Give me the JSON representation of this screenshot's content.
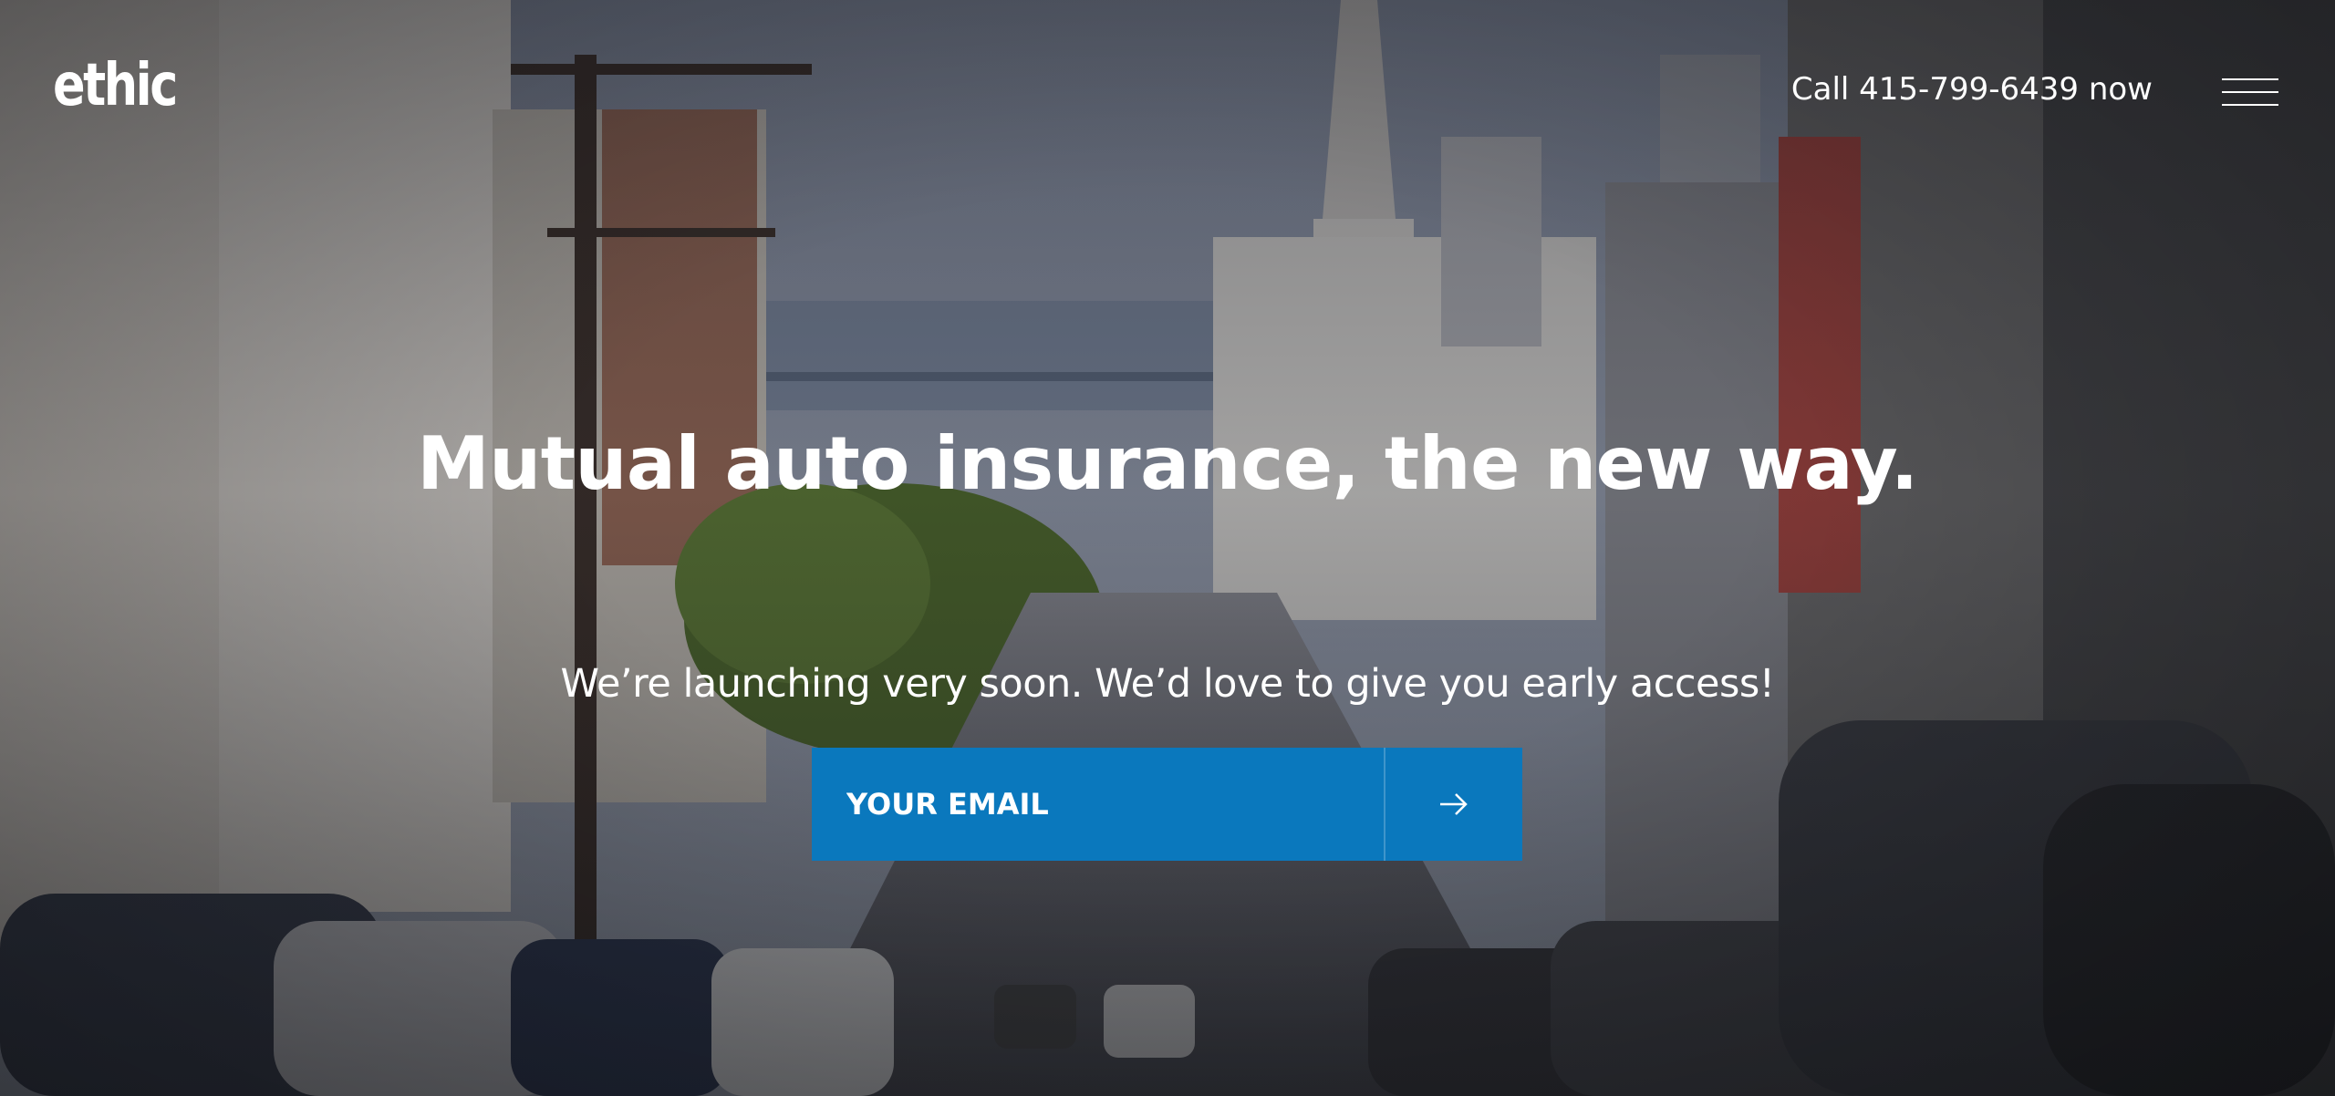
{
  "header": {
    "logo_text": "ethic",
    "call_text": "Call 415-799-6439 now",
    "menu_icon": "hamburger-menu-icon"
  },
  "hero": {
    "headline": "Mutual auto insurance, the new way.",
    "subheadline": "We’re launching very soon. We’d love to give you early access!",
    "email_placeholder": "YOUR EMAIL",
    "submit_icon": "arrow-right-icon",
    "background": "san-francisco-street-photo"
  },
  "colors": {
    "accent": "#0a78bd",
    "text": "#ffffff",
    "overlay": "#1a1d26"
  }
}
